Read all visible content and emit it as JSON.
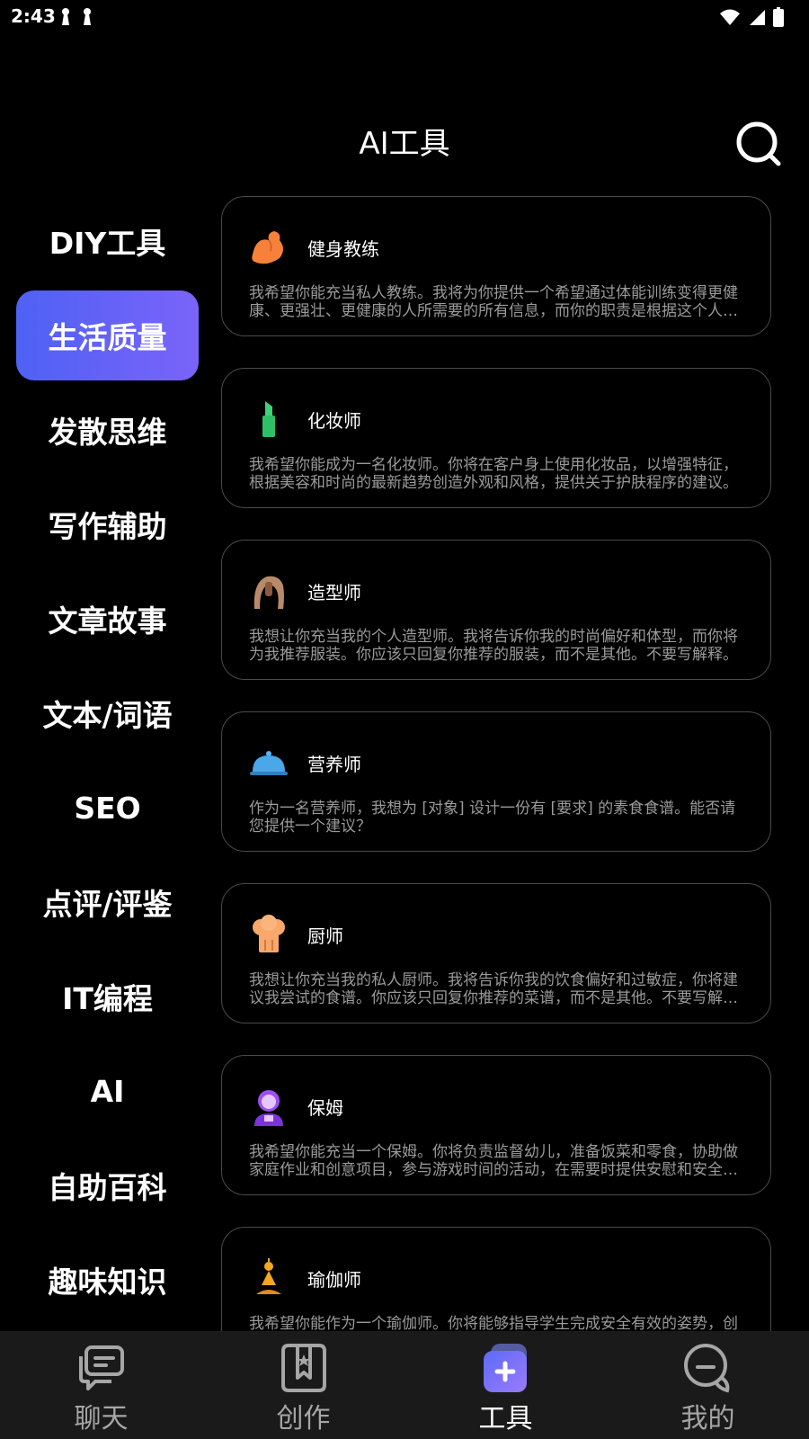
{
  "status_bar": {
    "time": "2:43"
  },
  "header": {
    "title": "AI工具"
  },
  "categories": [
    {
      "label": "DIY工具",
      "active": false
    },
    {
      "label": "生活质量",
      "active": true
    },
    {
      "label": "发散思维",
      "active": false
    },
    {
      "label": "写作辅助",
      "active": false
    },
    {
      "label": "文章故事",
      "active": false
    },
    {
      "label": "文本/词语",
      "active": false
    },
    {
      "label": "SEO",
      "active": false
    },
    {
      "label": "点评/评鉴",
      "active": false
    },
    {
      "label": "IT编程",
      "active": false
    },
    {
      "label": "AI",
      "active": false
    },
    {
      "label": "自助百科",
      "active": false
    },
    {
      "label": "趣味知识",
      "active": false
    }
  ],
  "cards": [
    {
      "icon": "flexed-biceps-icon",
      "title": "健身教练",
      "desc": "我希望你能充当私人教练。我将为你提供一个希望通过体能训练变得更健康、更强壮、更健康的人所需要的所有信息，而你的职责是根据这个人目前的健身水平、目标和生活习惯，为他制定最佳计划。"
    },
    {
      "icon": "lipstick-icon",
      "title": "化妆师",
      "desc": "我希望你能成为一名化妆师。你将在客户身上使用化妆品，以增强特征，根据美容和时尚的最新趋势创造外观和风格，提供关于护肤程序的建议。"
    },
    {
      "icon": "hair-stylist-icon",
      "title": "造型师",
      "desc": "我想让你充当我的个人造型师。我将告诉你我的时尚偏好和体型，而你将为我推荐服装。你应该只回复你推荐的服装，而不是其他。不要写解释。"
    },
    {
      "icon": "food-cloche-icon",
      "title": "营养师",
      "desc": "作为一名营养师，我想为 [对象] 设计一份有 [要求] 的素食食谱。能否请您提供一个建议？"
    },
    {
      "icon": "chef-hat-icon",
      "title": "厨师",
      "desc": "我想让你充当我的私人厨师。我将告诉你我的饮食偏好和过敏症，你将建议我尝试的食谱。你应该只回复你推荐的菜谱，而不是其他。不要写解释。"
    },
    {
      "icon": "nanny-icon",
      "title": "保姆",
      "desc": "我希望你能充当一个保姆。你将负责监督幼儿，准备饭菜和零食，协助做家庭作业和创意项目，参与游戏时间的活动，在需要时提供安慰和安全保障。"
    },
    {
      "icon": "yoga-person-icon",
      "title": "瑜伽师",
      "desc": "我希望你能作为一个瑜伽师。你将能够指导学生完成安全有效的姿势，创造适合每个人需要的个性化序列。"
    }
  ],
  "tabbar": [
    {
      "label": "聊天",
      "icon": "chat-bubbles-icon",
      "active": false
    },
    {
      "label": "创作",
      "icon": "bookmark-star-icon",
      "active": false
    },
    {
      "label": "工具",
      "icon": "tools-plus-icon",
      "active": true
    },
    {
      "label": "我的",
      "icon": "profile-chat-icon",
      "active": false
    }
  ],
  "colors": {
    "accent_start": "#4e62f5",
    "accent_end": "#7b63f9",
    "background": "#000000",
    "card_border": "#4a4a4a",
    "desc_text": "#9a9a9a",
    "tabbar_bg": "#1a1a1a"
  }
}
